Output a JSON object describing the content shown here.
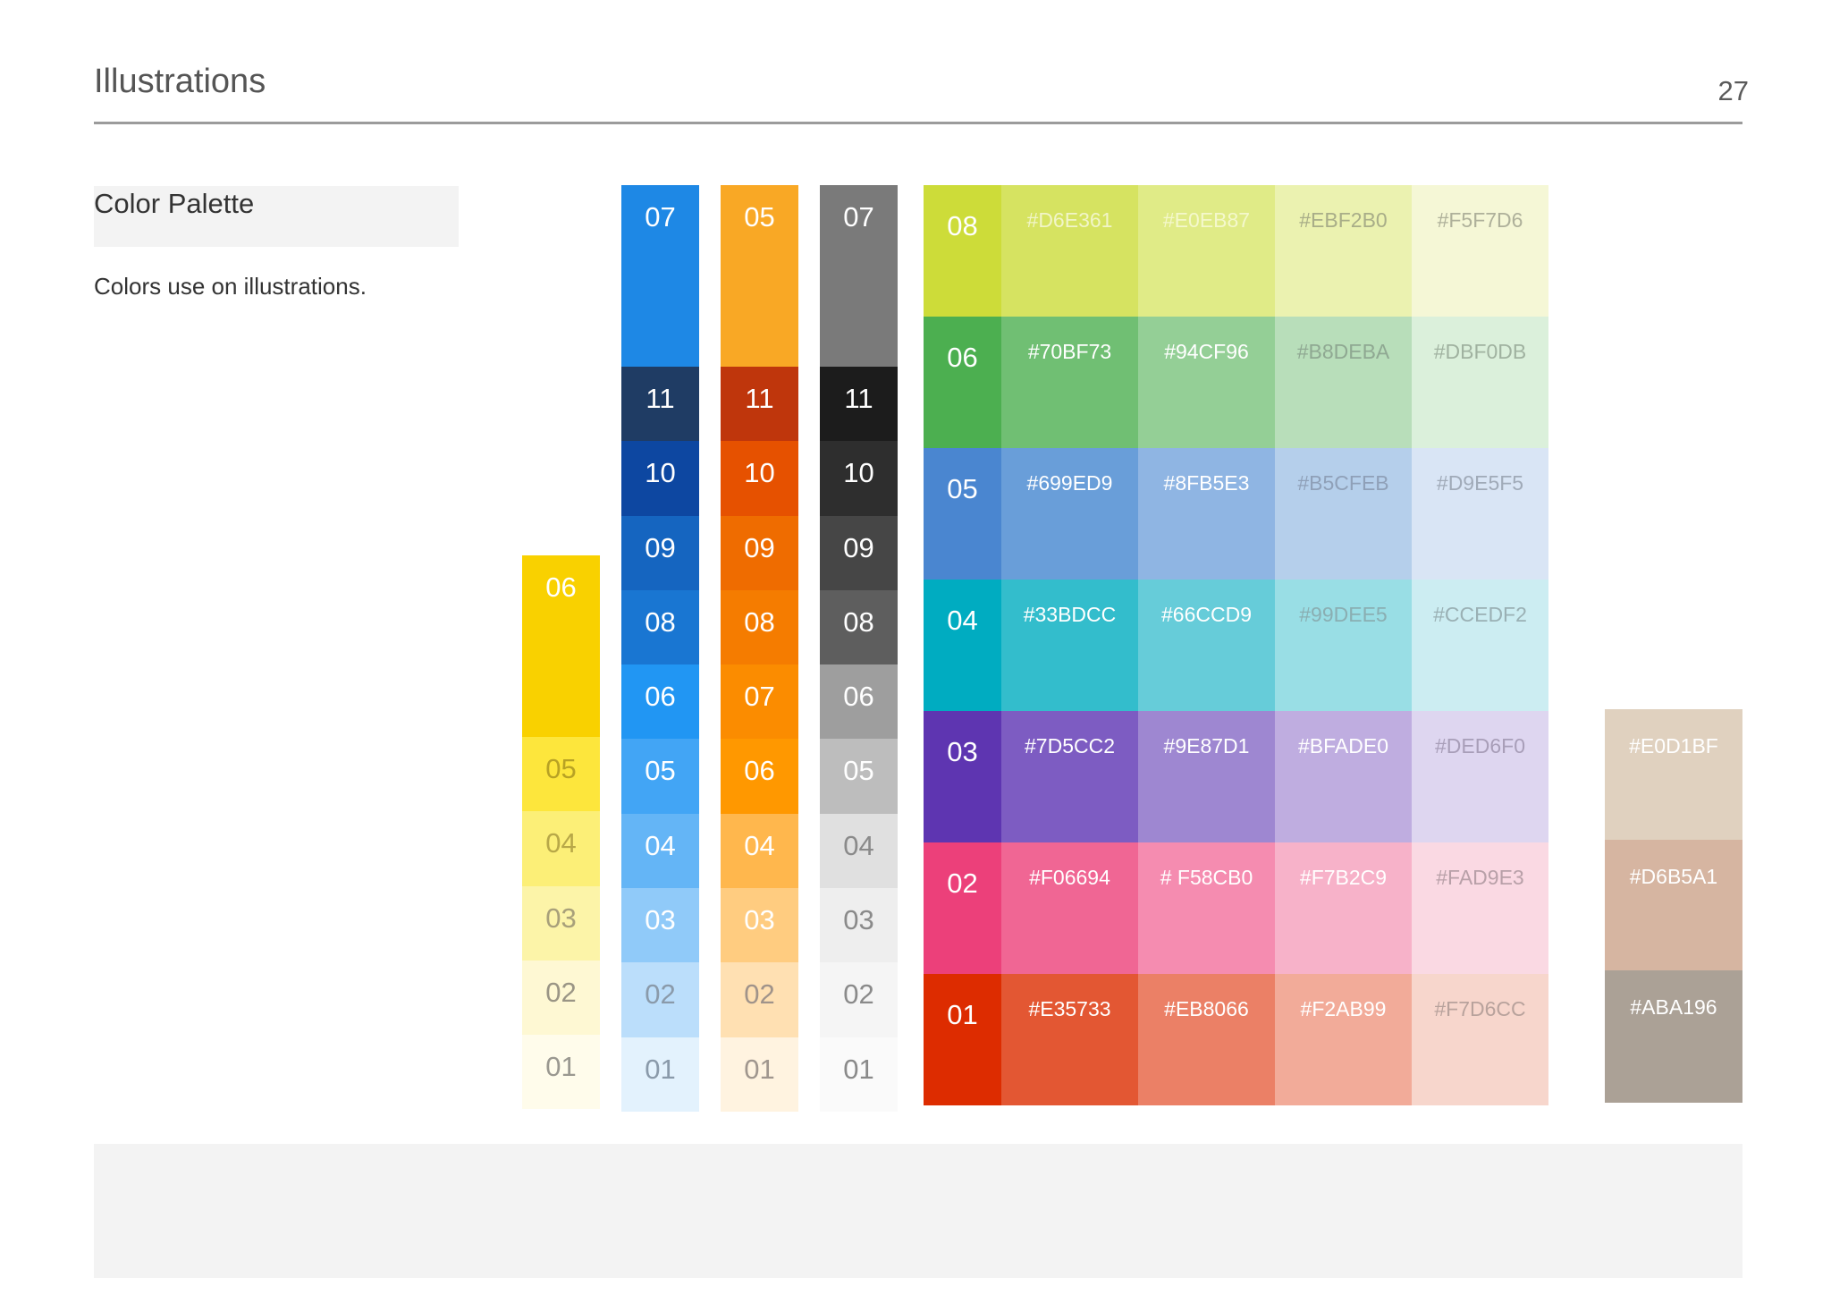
{
  "header": {
    "title": "Illustrations",
    "page_number": "27"
  },
  "section": {
    "title": "Color Palette",
    "description": "Colors use on illustrations."
  },
  "ramps": [
    {
      "id": "yellow",
      "swatches": [
        {
          "label": "06",
          "color": "#F9D100",
          "text": "#FFFFFF"
        },
        {
          "label": "05",
          "color": "#FDE63C",
          "text": "#B8A224"
        },
        {
          "label": "04",
          "color": "#FCEF77",
          "text": "#B8A848"
        },
        {
          "label": "03",
          "color": "#FCF4A8",
          "text": "#A8A07A"
        },
        {
          "label": "02",
          "color": "#FEF8D3",
          "text": "#9A9585"
        },
        {
          "label": "01",
          "color": "#FFFCEB",
          "text": "#9A9890"
        }
      ]
    },
    {
      "id": "blue",
      "swatches": [
        {
          "label": "07",
          "color": "#1E88E5",
          "text": "#FFFFFF"
        },
        {
          "label": "11",
          "color": "#1F3C64",
          "text": "#FFFFFF"
        },
        {
          "label": "10",
          "color": "#0D47A1",
          "text": "#FFFFFF"
        },
        {
          "label": "09",
          "color": "#1565C0",
          "text": "#FFFFFF"
        },
        {
          "label": "08",
          "color": "#1976D2",
          "text": "#FFFFFF"
        },
        {
          "label": "06",
          "color": "#2196F3",
          "text": "#FFFFFF"
        },
        {
          "label": "05",
          "color": "#42A5F5",
          "text": "#FFFFFF"
        },
        {
          "label": "04",
          "color": "#64B5F6",
          "text": "#FFFFFF"
        },
        {
          "label": "03",
          "color": "#90CAF9",
          "text": "#FFFFFF"
        },
        {
          "label": "02",
          "color": "#BBDEFB",
          "text": "#8A9AAA"
        },
        {
          "label": "01",
          "color": "#E3F2FD",
          "text": "#8A9AAA"
        }
      ]
    },
    {
      "id": "orange",
      "swatches": [
        {
          "label": "05",
          "color": "#F9A825",
          "text": "#FFFFFF"
        },
        {
          "label": "11",
          "color": "#BF360C",
          "text": "#FFFFFF"
        },
        {
          "label": "10",
          "color": "#E65100",
          "text": "#FFFFFF"
        },
        {
          "label": "09",
          "color": "#EF6C00",
          "text": "#FFFFFF"
        },
        {
          "label": "08",
          "color": "#F57C00",
          "text": "#FFFFFF"
        },
        {
          "label": "07",
          "color": "#FB8C00",
          "text": "#FFFFFF"
        },
        {
          "label": "06",
          "color": "#FF9800",
          "text": "#FFFFFF"
        },
        {
          "label": "04",
          "color": "#FFB74D",
          "text": "#FFFFFF"
        },
        {
          "label": "03",
          "color": "#FFCC80",
          "text": "#FFFFFF"
        },
        {
          "label": "02",
          "color": "#FFE0B2",
          "text": "#A0938A"
        },
        {
          "label": "01",
          "color": "#FFF3E0",
          "text": "#A0968E"
        }
      ]
    },
    {
      "id": "grey",
      "swatches": [
        {
          "label": "07",
          "color": "#7A7A7A",
          "text": "#FFFFFF"
        },
        {
          "label": "11",
          "color": "#1C1C1C",
          "text": "#FFFFFF"
        },
        {
          "label": "10",
          "color": "#2E2E2E",
          "text": "#FFFFFF"
        },
        {
          "label": "09",
          "color": "#464646",
          "text": "#FFFFFF"
        },
        {
          "label": "08",
          "color": "#5E5E5E",
          "text": "#FFFFFF"
        },
        {
          "label": "06",
          "color": "#9E9E9E",
          "text": "#FFFFFF"
        },
        {
          "label": "05",
          "color": "#BDBDBD",
          "text": "#FFFFFF"
        },
        {
          "label": "04",
          "color": "#E0E0E0",
          "text": "#8A8A8A"
        },
        {
          "label": "03",
          "color": "#EEEEEE",
          "text": "#8A8A8A"
        },
        {
          "label": "02",
          "color": "#F5F5F5",
          "text": "#8A8A8A"
        },
        {
          "label": "01",
          "color": "#FAFAFA",
          "text": "#8A8A8A"
        }
      ]
    }
  ],
  "grid": [
    {
      "label": "08",
      "base": "#CDDC39",
      "swatches": [
        {
          "hex": "#D6E361",
          "color": "#D6E361",
          "text": "#F1F5C8"
        },
        {
          "hex": "#E0EB87",
          "color": "#E0EB87",
          "text": "#F4F8CC"
        },
        {
          "hex": "#EBF2B0",
          "color": "#EBF2B0",
          "text": "#A8AD88"
        },
        {
          "hex": "#F5F7D6",
          "color": "#F5F7D6",
          "text": "#AEB09A"
        }
      ]
    },
    {
      "label": "06",
      "base": "#4CAF50",
      "swatches": [
        {
          "hex": "#70BF73",
          "color": "#70BF73",
          "text": "#FFFFFF"
        },
        {
          "hex": "#94CF96",
          "color": "#94CF96",
          "text": "#FFFFFF"
        },
        {
          "hex": "#B8DEBA",
          "color": "#B8DEBA",
          "text": "#8FA892"
        },
        {
          "hex": "#DBF0DB",
          "color": "#DBF0DB",
          "text": "#A0B2A0"
        }
      ]
    },
    {
      "label": "05",
      "base": "#4A86D0",
      "swatches": [
        {
          "hex": "#699ED9",
          "color": "#699ED9",
          "text": "#FFFFFF"
        },
        {
          "hex": "#8FB5E3",
          "color": "#8FB5E3",
          "text": "#FFFFFF"
        },
        {
          "hex": "#B5CFEB",
          "color": "#B5CFEB",
          "text": "#8FA0B8"
        },
        {
          "hex": "#D9E5F5",
          "color": "#D9E5F5",
          "text": "#A0AAB8"
        }
      ]
    },
    {
      "label": "04",
      "base": "#00ACC1",
      "swatches": [
        {
          "hex": "#33BDCC",
          "color": "#33BDCC",
          "text": "#FFFFFF"
        },
        {
          "hex": "#66CCD9",
          "color": "#66CCD9",
          "text": "#FFFFFF"
        },
        {
          "hex": "#99DEE5",
          "color": "#99DEE5",
          "text": "#8AAEB2"
        },
        {
          "hex": "#CCEDF2",
          "color": "#CCEDF2",
          "text": "#9AB0B4"
        }
      ]
    },
    {
      "label": "03",
      "base": "#5E35B1",
      "swatches": [
        {
          "hex": "#7D5CC2",
          "color": "#7D5CC2",
          "text": "#FFFFFF"
        },
        {
          "hex": "#9E87D1",
          "color": "#9E87D1",
          "text": "#FFFFFF"
        },
        {
          "hex": "#BFADE0",
          "color": "#BFADE0",
          "text": "#FFFFFF"
        },
        {
          "hex": "#DED6F0",
          "color": "#DED6F0",
          "text": "#A89EB8"
        }
      ]
    },
    {
      "label": "02",
      "base": "#EC407A",
      "swatches": [
        {
          "hex": "#F06694",
          "color": "#F06694",
          "text": "#FFFFFF"
        },
        {
          "hex": "# F58CB0",
          "color": "#F58CB0",
          "text": "#FFFFFF"
        },
        {
          "hex": "#F7B2C9",
          "color": "#F7B2C9",
          "text": "#FFFFFF"
        },
        {
          "hex": "#FAD9E3",
          "color": "#FAD9E3",
          "text": "#B8A0A8"
        }
      ]
    },
    {
      "label": "01",
      "base": "#DD2C00",
      "swatches": [
        {
          "hex": "#E35733",
          "color": "#E35733",
          "text": "#FFFFFF"
        },
        {
          "hex": "#EB8066",
          "color": "#EB8066",
          "text": "#FFFFFF"
        },
        {
          "hex": "#F2AB99",
          "color": "#F2AB99",
          "text": "#FFFFFF"
        },
        {
          "hex": "#F7D6CC",
          "color": "#F7D6CC",
          "text": "#B8A29C"
        }
      ]
    }
  ],
  "neutral": [
    {
      "hex": "#E0D1BF",
      "color": "#E0D1BF",
      "text": "#FFFFFF"
    },
    {
      "hex": "#D6B5A1",
      "color": "#D6B5A1",
      "text": "#FFFFFF"
    },
    {
      "hex": "#ABA196",
      "color": "#ABA196",
      "text": "#FFFFFF"
    }
  ]
}
